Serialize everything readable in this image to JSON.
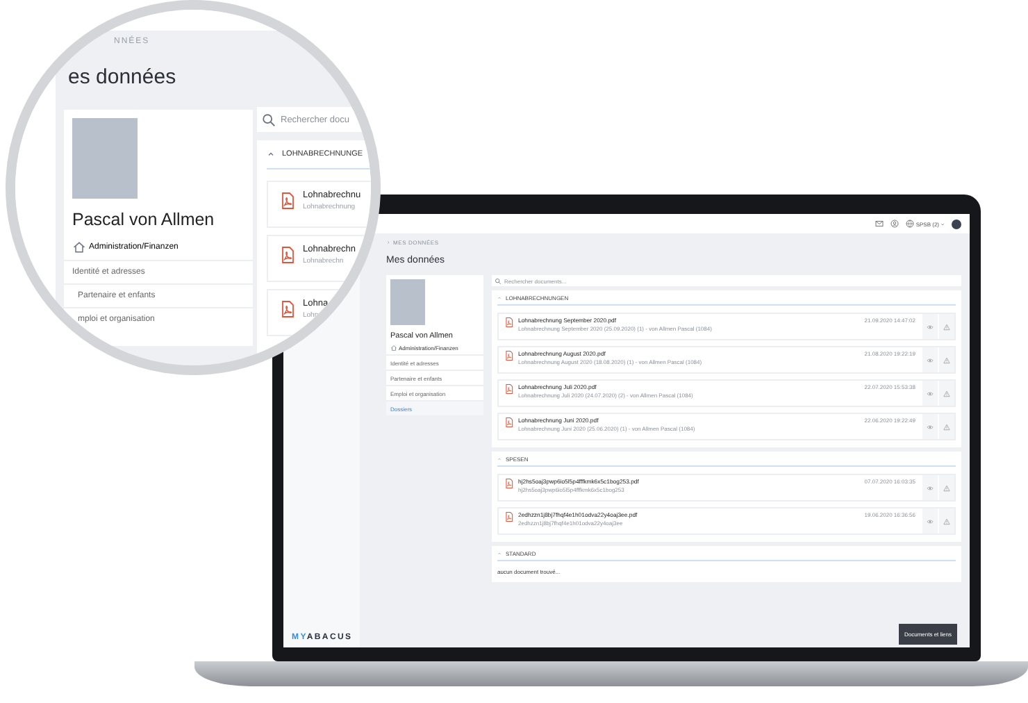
{
  "laptop_screen": {
    "top_bar": {
      "account": "SPSB (2)"
    },
    "breadcrumb": "MES DONNÉES",
    "page_title": "Mes données",
    "profile": {
      "name": "Pascal von Allmen",
      "department": "Administration/Finanzen",
      "menu": [
        {
          "label": "Identité et adresses",
          "selected": false
        },
        {
          "label": "Partenaire et enfants",
          "selected": false
        },
        {
          "label": "Emploi et organisation",
          "selected": false
        },
        {
          "label": "Dossiers",
          "selected": true
        }
      ]
    },
    "search": {
      "placeholder": "Rechercher documents..."
    },
    "sections": [
      {
        "title": "LOHNABRECHNUNGEN",
        "documents": [
          {
            "name": "Lohnabrechnung September 2020.pdf",
            "details": "Lohnabrechnung September 2020 (25.09.2020) (1) - von Allmen Pascal (1084)",
            "date": "21.09.2020 14:47:02"
          },
          {
            "name": "Lohnabrechnung August 2020.pdf",
            "details": "Lohnabrechnung August 2020 (18.08.2020) (1) - von Allmen Pascal (1084)",
            "date": "21.08.2020 19:22:19"
          },
          {
            "name": "Lohnabrechnung Juli 2020.pdf",
            "details": "Lohnabrechnung Juli 2020 (24.07.2020) (2) - von Allmen Pascal (1084)",
            "date": "22.07.2020 15:53:38"
          },
          {
            "name": "Lohnabrechnung Juni 2020.pdf",
            "details": "Lohnabrechnung Juni 2020 (25.06.2020) (1) - von Allmen Pascal (1084)",
            "date": "22.06.2020 19:22:49"
          }
        ]
      },
      {
        "title": "SPESEN",
        "documents": [
          {
            "name": "hj2hs5oaj3pwp6io5l5p4fffkmk6x5c1bog253.pdf",
            "details": "hj2hs5oaj3pwp6io5l5p4fffkmk6x5c1bog253",
            "date": "07.07.2020 16:03:35"
          },
          {
            "name": "2edhzzn1j8bj7fhqf4e1h01odva22y4oaj3ee.pdf",
            "details": "2edhzzn1j8bj7fhqf4e1h01odva22y4oaj3ee",
            "date": "19.06.2020 16:36:56"
          }
        ]
      },
      {
        "title": "STANDARD",
        "empty_text": "aucun document trouvé..."
      }
    ],
    "footer_button": "Documents et liens",
    "logo": {
      "prefix": "MY",
      "name": "ABACUS"
    }
  },
  "magnifier": {
    "breadcrumb": "NNÉES",
    "page_title": "es données",
    "profile": {
      "name": "Pascal von Allmen",
      "department": "Administration/Finanzen",
      "menu": [
        "Identité et adresses",
        "Partenaire et enfants",
        "mploi et organisation"
      ]
    },
    "search": {
      "placeholder": "Rechercher docu"
    },
    "section_title": "LOHNABRECHNUNGE",
    "documents": [
      {
        "name": "Lohnabrechnu",
        "details": "Lohnabrechnung"
      },
      {
        "name": "Lohnabrechn",
        "details": "Lohnabrechn"
      },
      {
        "name": "Lohna",
        "details": "Lohn"
      }
    ]
  }
}
